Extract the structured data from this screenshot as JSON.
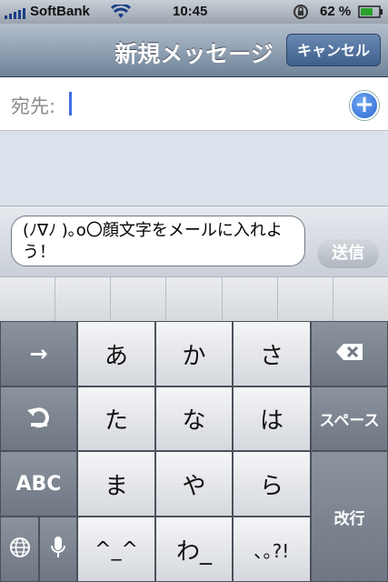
{
  "status_bar": {
    "carrier": "SoftBank",
    "time": "10:45",
    "battery": "62 %"
  },
  "nav": {
    "title": "新規メッセージ",
    "cancel_label": "キャンセル"
  },
  "to_field": {
    "label": "宛先:",
    "add_icon": "plus-circle-icon"
  },
  "compose": {
    "message_text": "(ﾉ∇ﾉ )｡o〇顔文字をメールに入れよう！",
    "send_label": "送信"
  },
  "keyboard": {
    "keys": {
      "a": "あ",
      "ka": "か",
      "sa": "さ",
      "ta": "た",
      "na": "な",
      "ha": "は",
      "ma": "ま",
      "ya": "や",
      "ra": "ら",
      "dakuten": "^_^",
      "wa": "わ_",
      "punct": "､｡?!",
      "space": "スペース",
      "abc": "ABC",
      "return": "改行"
    },
    "icons": {
      "arrow": "→",
      "undo": "undo-icon",
      "backspace": "backspace-icon",
      "globe": "globe-icon",
      "mic": "microphone-icon"
    }
  }
}
